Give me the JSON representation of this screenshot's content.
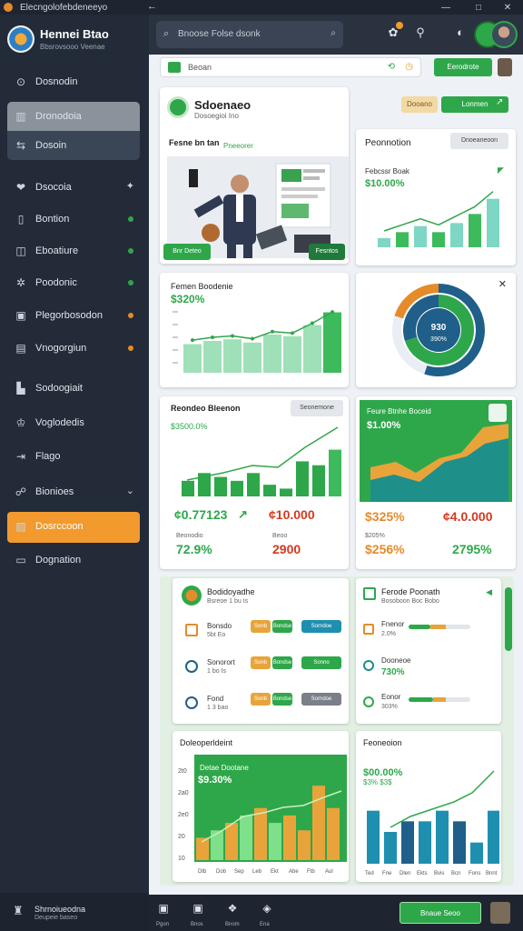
{
  "window": {
    "title": "Elecngolofebdeneeyo",
    "back": "←",
    "controls": [
      "—",
      "□",
      "✕"
    ]
  },
  "sidebar": {
    "brand_name": "Hennei Btao",
    "brand_sub": "Bbsrovsooo Veenae",
    "items": [
      {
        "label": "Dosnodin",
        "icon": "⊙"
      },
      {
        "label": "Dronodoia",
        "icon": "▥"
      },
      {
        "label": "Dosoin",
        "icon": "⇆"
      },
      {
        "label": "Dsocoia",
        "icon": "❤",
        "side": "✦"
      },
      {
        "label": "Bontion",
        "icon": "▯",
        "dot": "#2ea74a"
      },
      {
        "label": "Eboatiure",
        "icon": "◫",
        "dot": "#2ea74a"
      },
      {
        "label": "Poodonic",
        "icon": "✲",
        "dot": "#2ea74a"
      },
      {
        "label": "Plegorbosodon",
        "icon": "▣",
        "dot": "#e58b2a"
      },
      {
        "label": "Vnogorgiun",
        "icon": "▤",
        "dot": "#e58b2a"
      },
      {
        "label": "Sodoogiait",
        "icon": "▙"
      },
      {
        "label": "Voglodedis",
        "icon": "♔"
      },
      {
        "label": "Flago",
        "icon": "⇥"
      },
      {
        "label": "Bionioes",
        "icon": "☍",
        "side": "⌄"
      },
      {
        "label": "Dosrccoon",
        "icon": "▨"
      },
      {
        "label": "Dognation",
        "icon": "▭"
      }
    ],
    "footer_name": "Shrnoiueodna",
    "footer_sub": "Deupeie baseo"
  },
  "header": {
    "search_placeholder": "Bnoose Folse dsonk",
    "search_icon": "⌕",
    "mic_icon": "⌕",
    "icons": [
      "✿",
      "⚲",
      "◐"
    ]
  },
  "filter": {
    "text": "Beoan",
    "icon2": "⟲",
    "icon3": "◷",
    "button": "Eerodrote"
  },
  "card1": {
    "title": "Sdoenaeo",
    "sub": "Dosoegioi Ino",
    "btn1": "Dooano",
    "btn2": "Lonmen",
    "headline": "Fesne bn tan",
    "headline2": "Pneeorer",
    "img_btn1": "Bnr Deteo",
    "img_btn2": "Fesntos"
  },
  "card2": {
    "title": "Peonnotion",
    "btn": "Dnoeaneoon",
    "metric_label": "Febcssr Boak",
    "metric": "$10.00%",
    "bars": [
      3,
      5,
      7,
      5,
      8,
      11,
      16
    ]
  },
  "card3": {
    "title": "Femen Boodenie",
    "metric": "$320%",
    "bars": [
      18,
      20,
      21,
      19,
      24,
      23,
      30,
      38
    ]
  },
  "card4": {
    "value": "930",
    "pct": "390%",
    "close": "✕",
    "slices": [
      0.5,
      0.28,
      0.22
    ]
  },
  "card5": {
    "title": "Reondeo Bleenon",
    "btn": "Seonemone",
    "metric": "$3500.0%",
    "left_value": "¢0.77123",
    "arrow": "↗",
    "right_value": "¢10.000",
    "l_label": "Beonodio",
    "l_pct": "72.9%",
    "r_label": "Beoo",
    "r_value": "2900",
    "bars": [
      4,
      6,
      5,
      4,
      6,
      3,
      2,
      9,
      8,
      12
    ]
  },
  "card6": {
    "title": "Feure Btnhe Boceid",
    "metric": "$1.00%",
    "l_pct": "$325%",
    "r_value": "¢4.0.000",
    "l_label": "$205%",
    "l_label2": "$256%",
    "r_label": "2795%"
  },
  "card7": {
    "title": "Bodidoyadhe",
    "sub": "Bsreoe 1 bu Is",
    "rows": [
      {
        "name": "Bonsdo",
        "val": "5bt Eo"
      },
      {
        "name": "Sonorort",
        "val": "1 bo Is"
      },
      {
        "name": "Fond",
        "val": "1 3 bao"
      }
    ],
    "pills": [
      "Sonb",
      "Bondse",
      "Sonno",
      "Sorndoe"
    ]
  },
  "card8": {
    "title": "Ferode Poonath",
    "sub": "Bosoboon Boc Bobo",
    "rows": [
      {
        "name": "Fnenor",
        "val": "2.0%",
        "g": 0.35,
        "o": 0.25
      },
      {
        "name": "Dooneoe",
        "val": "730%",
        "g": 0,
        "o": 0
      },
      {
        "name": "Eonor",
        "val": "303%",
        "g": 0.4,
        "o": 0.2
      }
    ]
  },
  "card9": {
    "title": "Doleoperldeint",
    "sub_title": "Detae Dootane",
    "metric": "$9.30%",
    "bars": [
      3,
      4,
      5,
      6,
      7,
      5,
      6,
      4,
      10,
      7
    ],
    "ticks": [
      "2t0",
      "2a0",
      "2e0",
      "20",
      "10"
    ],
    "xl": [
      "Dtb",
      "Dob",
      "Sep",
      "Leb",
      "Ekt",
      "Abe",
      "Ftb",
      "Aul"
    ]
  },
  "card10": {
    "title": "Feoneoion",
    "metric": "$00.00%",
    "metric2": "$3% $3$",
    "bars": [
      5,
      3,
      4,
      4,
      5,
      4,
      2,
      5
    ],
    "xl": [
      "Ted",
      "Fne",
      "Dlen",
      "Ekts",
      "Bvis",
      "Bcn",
      "Fons",
      "Bnnt"
    ]
  },
  "bottom": {
    "items": [
      {
        "icon": "▣",
        "label": "Pgon"
      },
      {
        "icon": "▣",
        "label": "Bnos"
      },
      {
        "icon": "❖",
        "label": "Bnom"
      },
      {
        "icon": "◈",
        "label": "Ena"
      }
    ],
    "btn": "Bnaue Seoo"
  }
}
